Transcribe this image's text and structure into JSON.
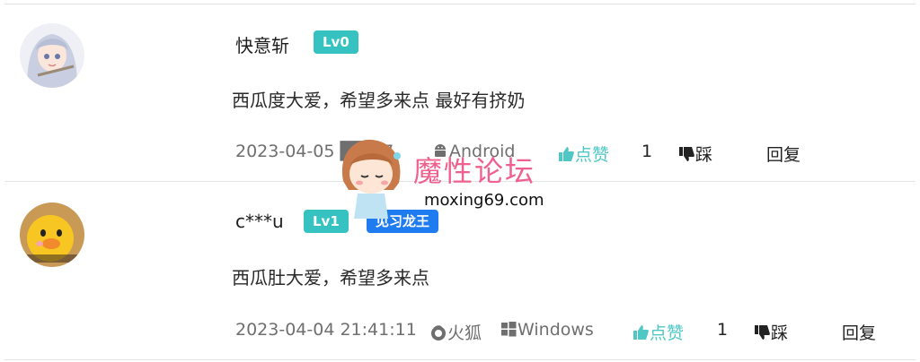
{
  "comments": [
    {
      "username": "快意斩",
      "level": "Lv0",
      "content": "西瓜度大爱，希望多来点 最好有挤奶",
      "datetime": "2023-04-05 ██:27",
      "platform": "Android",
      "like_label": "点赞",
      "like_count": "1",
      "dislike_label": "踩",
      "reply_label": "回复",
      "avatar_icon": "anime-girl-avatar"
    },
    {
      "username": "c***u",
      "level": "Lv1",
      "title_badge": "见习龙王",
      "content": "西瓜肚大爱，希望多来点",
      "datetime": "2023-04-04 21:41:11",
      "browser": "火狐",
      "platform": "Windows",
      "like_label": "点赞",
      "like_count": "1",
      "dislike_label": "踩",
      "reply_label": "回复",
      "avatar_icon": "yellow-duck-avatar"
    }
  ],
  "watermark": {
    "text": "魔性论坛",
    "url": "moxing69.com"
  },
  "colors": {
    "level_badge": "#35c2c0",
    "title_badge": "#1f7cf0",
    "like": "#4fc7c5",
    "watermark": "#f0608e"
  }
}
